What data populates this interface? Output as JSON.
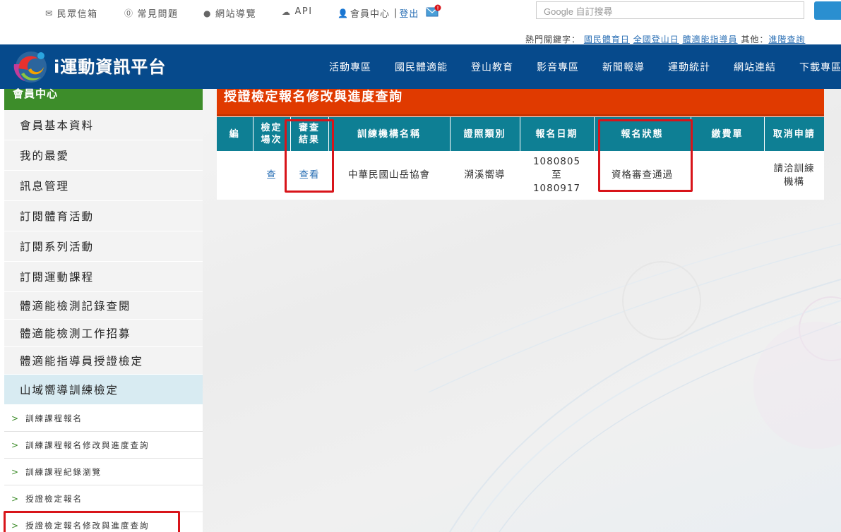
{
  "topbar": {
    "links": [
      {
        "label": "民眾信箱",
        "icon": "envelope-icon"
      },
      {
        "label": "常見問題",
        "icon": "question-icon"
      },
      {
        "label": "網站導覽",
        "icon": "globe-icon"
      },
      {
        "label": "API",
        "icon": "cloud-icon"
      }
    ],
    "member_center": "會員中心",
    "separator": "|",
    "logout": "登出",
    "search_placeholder": "Google 自訂搜尋"
  },
  "hotkeys": {
    "label": "熱門關鍵字：",
    "items": [
      "國民體育日",
      "全國登山日",
      "體適能指導員"
    ],
    "other_label": "其他：",
    "advanced": "進階查詢"
  },
  "nav": {
    "logo_text": "i運動資訊平台",
    "items": [
      "活動專區",
      "國民體適能",
      "登山教育",
      "影音專區",
      "新聞報導",
      "運動統計",
      "網站連結",
      "下載專區"
    ]
  },
  "sidebar": {
    "header": "會員中心",
    "items": [
      "會員基本資料",
      "我的最愛",
      "訊息管理",
      "訂閱體育活動",
      "訂閱系列活動",
      "訂閱運動課程",
      "體適能檢測記錄查閱",
      "體適能檢測工作招募",
      "體適能指導員授證檢定",
      "山域嚮導訓練檢定"
    ],
    "subitems": [
      "訓練課程報名",
      "訓練課程報名修改與進度查詢",
      "訓練課程紀錄瀏覽",
      "授證檢定報名",
      "授證檢定報名修改與進度查詢"
    ]
  },
  "panel": {
    "title": "授證檢定報名修改與進度查詢",
    "columns": [
      "編",
      "檢定場次",
      "審查結果",
      "訓練機構名稱",
      "證照類別",
      "報名日期",
      "報名狀態",
      "繳費單",
      "取消申請"
    ],
    "col_lines": {
      "c1a": "檢定",
      "c1b": "場次",
      "c2a": "審查",
      "c2b": "結果"
    },
    "row": {
      "num": "",
      "session": "查",
      "review": "查看",
      "org": "中華民國山岳協會",
      "license": "溯溪嚮導",
      "date_from": "1080805",
      "date_to_label": "至",
      "date_to": "1080917",
      "status": "資格審查通過",
      "payment": "",
      "cancel_line1": "請洽訓練",
      "cancel_line2": "機構"
    }
  },
  "colors": {
    "nav_blue": "#064a8c",
    "title_red": "#e03a00",
    "table_header_teal": "#0e7f94",
    "sidebar_green": "#3d8d2a",
    "highlight_red": "#d8141a"
  }
}
